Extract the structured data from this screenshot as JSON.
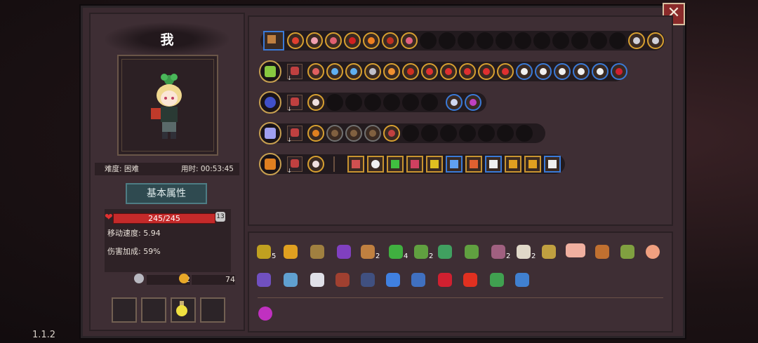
{
  "version": "1.1.2",
  "close_label": "✕",
  "player": {
    "name": "我",
    "difficulty": "难度: 困难",
    "time_label": "用时: 00:53:45",
    "attr_button": "基本属性",
    "hp_text": "245/245",
    "shield_value": "13",
    "move_speed": "移动速度: 5.94",
    "damage_bonus": "伤害加成: 59%",
    "keys": "2",
    "coins": "74"
  },
  "colors": {
    "accent": "#d8a030",
    "hp": "#c42a2a",
    "blue_border": "#3a7ad8"
  },
  "items": {
    "row1_counts": [
      "5",
      "",
      "",
      "",
      "2",
      "4",
      "2",
      "",
      "",
      "2",
      "2",
      "",
      "",
      "",
      ""
    ],
    "row2_counts": [
      "",
      "",
      "",
      "",
      "",
      "",
      "",
      "",
      "",
      "",
      "",
      ""
    ]
  }
}
